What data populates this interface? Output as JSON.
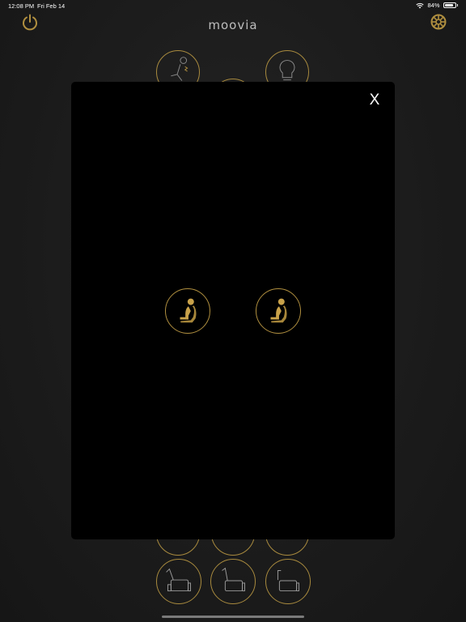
{
  "status_bar": {
    "time": "12:08 PM",
    "date": "Fri Feb 14",
    "battery": "84%",
    "battery_level": 0.84
  },
  "header": {
    "logo": "moovia",
    "power_icon": "power-icon",
    "settings_icon": "gear-icon"
  },
  "modal": {
    "close_label": "X",
    "seats": [
      {
        "icon": "seat-position-icon"
      },
      {
        "icon": "seat-position-icon"
      }
    ]
  },
  "colors": {
    "accent_gold": "#b08f3f",
    "background": "#1c1c1c",
    "modal_background": "#000000"
  }
}
